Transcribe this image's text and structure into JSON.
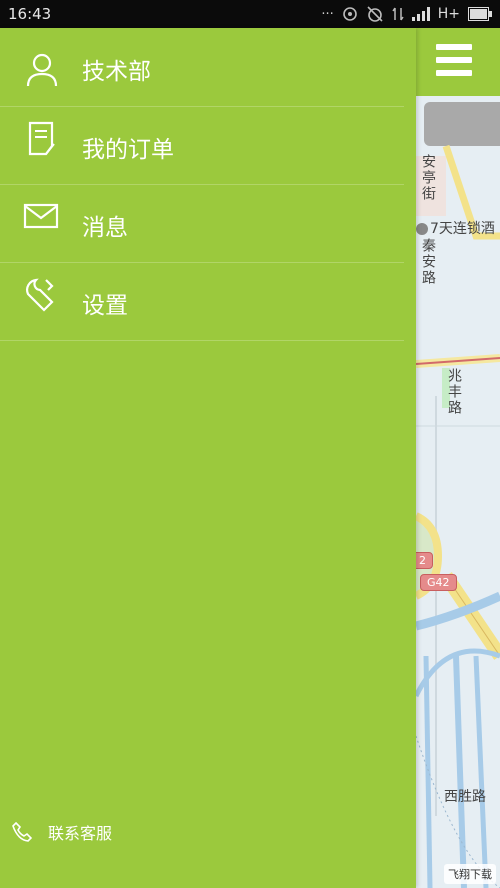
{
  "status_bar": {
    "time": "16:43",
    "network": "H+"
  },
  "drawer": {
    "items": [
      {
        "label": "技术部",
        "icon": "user-icon"
      },
      {
        "label": "我的订单",
        "icon": "order-list-icon"
      },
      {
        "label": "消息",
        "icon": "message-envelope-icon"
      },
      {
        "label": "设置",
        "icon": "settings-wrench-icon"
      }
    ],
    "contact_label": "联系客服",
    "contact_icon": "phone-icon"
  },
  "map": {
    "labels": [
      "安亭街",
      "7天连锁酒",
      "秦安路",
      "兆丰路",
      "西胜路"
    ],
    "road_badges": [
      "2",
      "G42"
    ]
  },
  "watermark": "飞翔下载"
}
